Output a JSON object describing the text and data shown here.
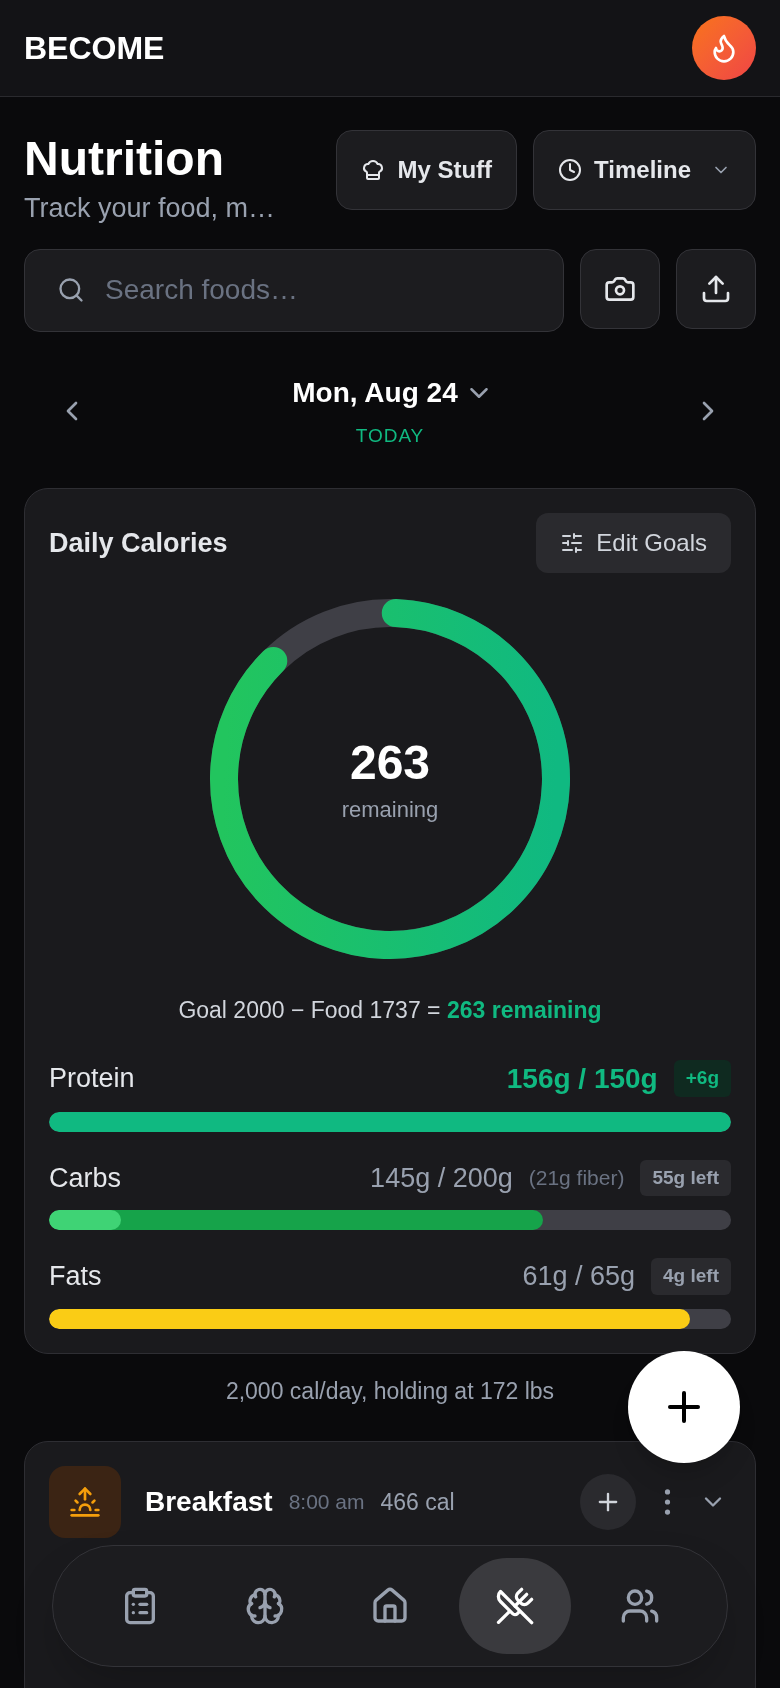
{
  "header": {
    "brand": "BECOME"
  },
  "page": {
    "title": "Nutrition",
    "subtitle": "Track your food, m…"
  },
  "actions": [
    {
      "label": "My Stuff",
      "kind": "chef"
    },
    {
      "label": "Timeline",
      "kind": "timeline"
    }
  ],
  "search": {
    "placeholder": "Search foods…"
  },
  "date": {
    "label": "Mon, Aug 24",
    "relative": "TODAY"
  },
  "calories": {
    "title": "Daily Calories",
    "edit_label": "Edit Goals",
    "remaining": "263",
    "remaining_label": "remaining",
    "level": 0.87,
    "equation": "Goal 2000 − Food 1737 = ",
    "equation_result": "263 remaining"
  },
  "macros": [
    {
      "name": "Protein",
      "amount": "156g / 150g",
      "kind": "over",
      "badge": "+6g",
      "level": 1,
      "color": "#10b981"
    },
    {
      "name": "Carbs",
      "amount": "145g / 200g",
      "note": "(21g fiber)",
      "kind": "under",
      "badge": "55g left",
      "level": 0.725,
      "fiber": {
        "level": 0.105
      },
      "color": "#16a34a"
    },
    {
      "name": "Fats",
      "amount": "61g / 65g",
      "kind": "under",
      "badge": "4g left",
      "level": 0.94,
      "color": "#facc15"
    }
  ],
  "plan_note": "2,000 cal/day, holding at 172 lbs",
  "meals": [
    {
      "name": "Breakfast",
      "time": "8:00 am",
      "calories": "466 cal",
      "expanded": false
    }
  ],
  "nav": [
    {
      "kind": "log",
      "selected": false
    },
    {
      "kind": "brain",
      "selected": false
    },
    {
      "kind": "home",
      "selected": false
    },
    {
      "kind": "food",
      "selected": true
    },
    {
      "kind": "people",
      "selected": false
    }
  ]
}
